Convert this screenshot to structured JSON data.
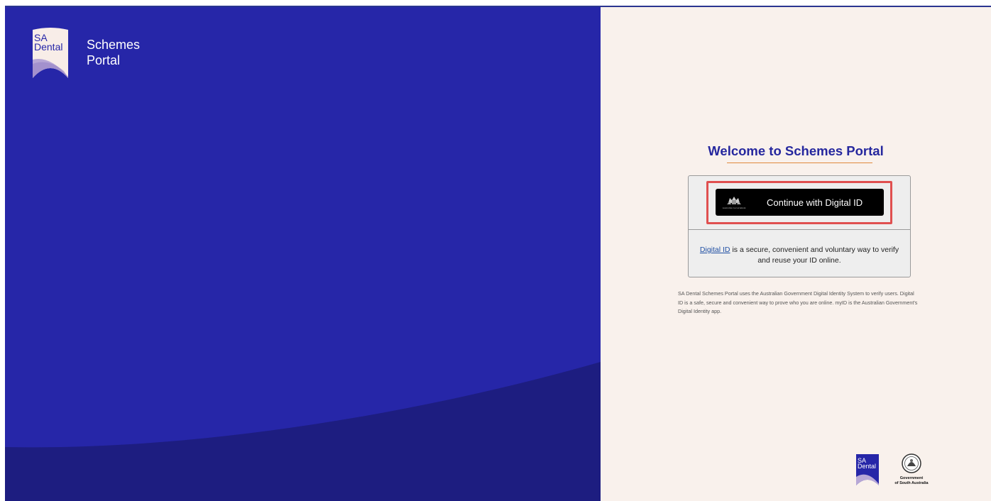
{
  "brand": {
    "logo_line1": "SA",
    "logo_line2": "Dental",
    "name_line1": "Schemes",
    "name_line2": "Portal"
  },
  "main": {
    "title": "Welcome to Schemes Portal",
    "button_label": "Continue with Digital ID",
    "button_crest_caption": "Australian Government",
    "info_link": "Digital ID",
    "info_text_1": " is a secure, convenient and voluntary way to verify",
    "info_text_2": "and reuse your ID online.",
    "disclaimer": "SA Dental Schemes Portal uses the Australian Government Digital Identity System to verify users. Digital ID is a safe, secure and convenient way to prove who you are online. myID is the Australian Government's Digital Identity app."
  },
  "footer": {
    "sa_logo_line1": "SA",
    "sa_logo_line2": "Dental",
    "gov_line1": "Government",
    "gov_line2": "of South Australia"
  },
  "colors": {
    "left_panel": "#2626a8",
    "wave": "#1d1d80",
    "right_panel": "#f9f1ec",
    "title": "#25279e",
    "accent_rule": "#e08a3c",
    "highlight": "#e05050"
  },
  "icons": {
    "brand_logo": "sa-dental-logo-icon",
    "crest": "australian-government-crest-icon",
    "footer_sa": "sa-dental-logo-icon",
    "footer_gov": "government-of-south-australia-seal-icon"
  }
}
